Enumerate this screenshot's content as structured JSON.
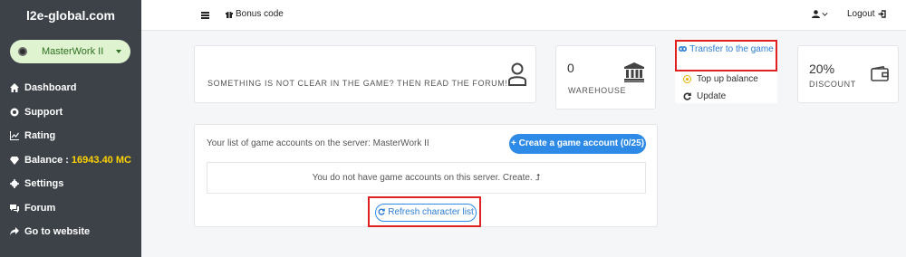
{
  "sidebar": {
    "brand": "l2e-global.com",
    "server": "MasterWork II",
    "items": [
      {
        "label": "Dashboard",
        "icon": "home-icon"
      },
      {
        "label": "Support",
        "icon": "lifebuoy-icon"
      },
      {
        "label": "Rating",
        "icon": "chart-icon"
      },
      {
        "label": "Balance :",
        "value": "16943.40 MC",
        "icon": "diamond-icon"
      },
      {
        "label": "Settings",
        "icon": "gear-icon"
      },
      {
        "label": "Forum",
        "icon": "comments-icon"
      },
      {
        "label": "Go to website",
        "icon": "share-icon"
      }
    ],
    "balance_color": "#ffd200"
  },
  "topbar": {
    "bonus": "Bonus code",
    "logout": "Logout"
  },
  "forum_card": {
    "text": "SOMETHING IS NOT CLEAR IN THE GAME? THEN READ THE FORUM!"
  },
  "warehouse": {
    "value": "0",
    "label": "WAREHOUSE"
  },
  "actions": {
    "transfer": "Transfer to the game",
    "topup": "Top up balance",
    "update": "Update"
  },
  "discount": {
    "value": "20%",
    "label": "DISCOUNT"
  },
  "accounts": {
    "title": "Your list of game accounts on the server: MasterWork II",
    "create": "Create a game account (0/25)",
    "empty": "You do not have game accounts on this server. Create. ⮥",
    "refresh": "Refresh character list"
  },
  "colors": {
    "sidebar_bg": "#3c4248",
    "accent": "#2d8ae6",
    "highlight": "#e32020"
  }
}
